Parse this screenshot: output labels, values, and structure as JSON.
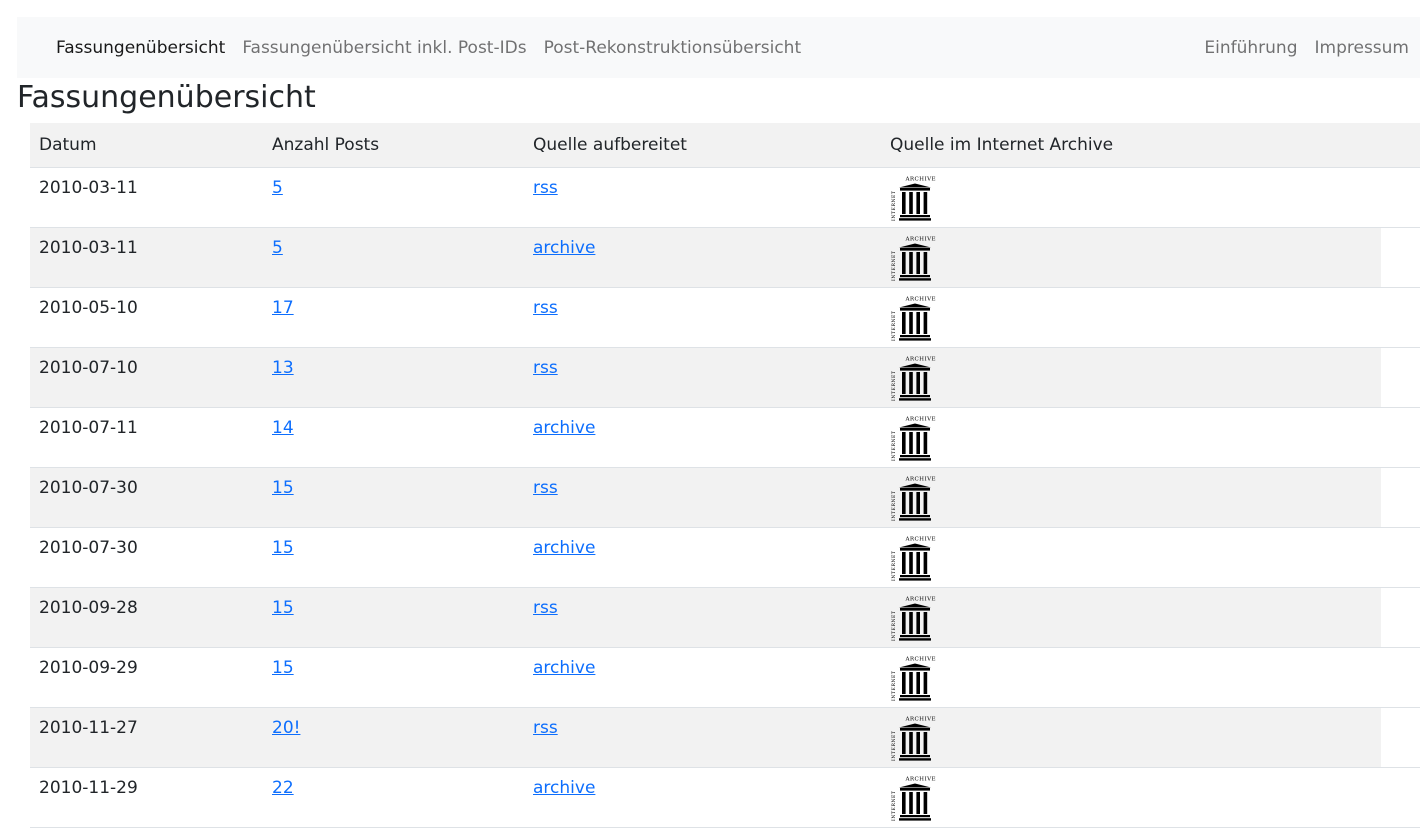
{
  "nav": {
    "left": [
      {
        "label": "Fassungenübersicht",
        "active": true
      },
      {
        "label": "Fassungenübersicht inkl. Post-IDs",
        "active": false
      },
      {
        "label": "Post-Rekonstruktionsübersicht",
        "active": false
      }
    ],
    "right": [
      {
        "label": "Einführung"
      },
      {
        "label": "Impressum"
      }
    ]
  },
  "page": {
    "title": "Fassungenübersicht"
  },
  "table": {
    "headers": [
      "Datum",
      "Anzahl Posts",
      "Quelle aufbereitet",
      "Quelle im Internet Archive"
    ],
    "rows": [
      {
        "date": "2010-03-11",
        "posts": "5",
        "source": "rss"
      },
      {
        "date": "2010-03-11",
        "posts": "5",
        "source": "archive"
      },
      {
        "date": "2010-05-10",
        "posts": "17",
        "source": "rss"
      },
      {
        "date": "2010-07-10",
        "posts": "13",
        "source": "rss"
      },
      {
        "date": "2010-07-11",
        "posts": "14",
        "source": "archive"
      },
      {
        "date": "2010-07-30",
        "posts": "15",
        "source": "rss"
      },
      {
        "date": "2010-07-30",
        "posts": "15",
        "source": "archive"
      },
      {
        "date": "2010-09-28",
        "posts": "15",
        "source": "rss"
      },
      {
        "date": "2010-09-29",
        "posts": "15",
        "source": "archive"
      },
      {
        "date": "2010-11-27",
        "posts": "20!",
        "source": "rss"
      },
      {
        "date": "2010-11-29",
        "posts": "22",
        "source": "archive"
      }
    ]
  },
  "logo": {
    "archive_text": "ARCHIVE",
    "internet_text": "INTERNET",
    "icon": "internet-archive-icon"
  },
  "colors": {
    "link": "#0d6efd",
    "navbar_bg": "#f8f9fa",
    "stripe_bg": "#f2f2f2"
  }
}
